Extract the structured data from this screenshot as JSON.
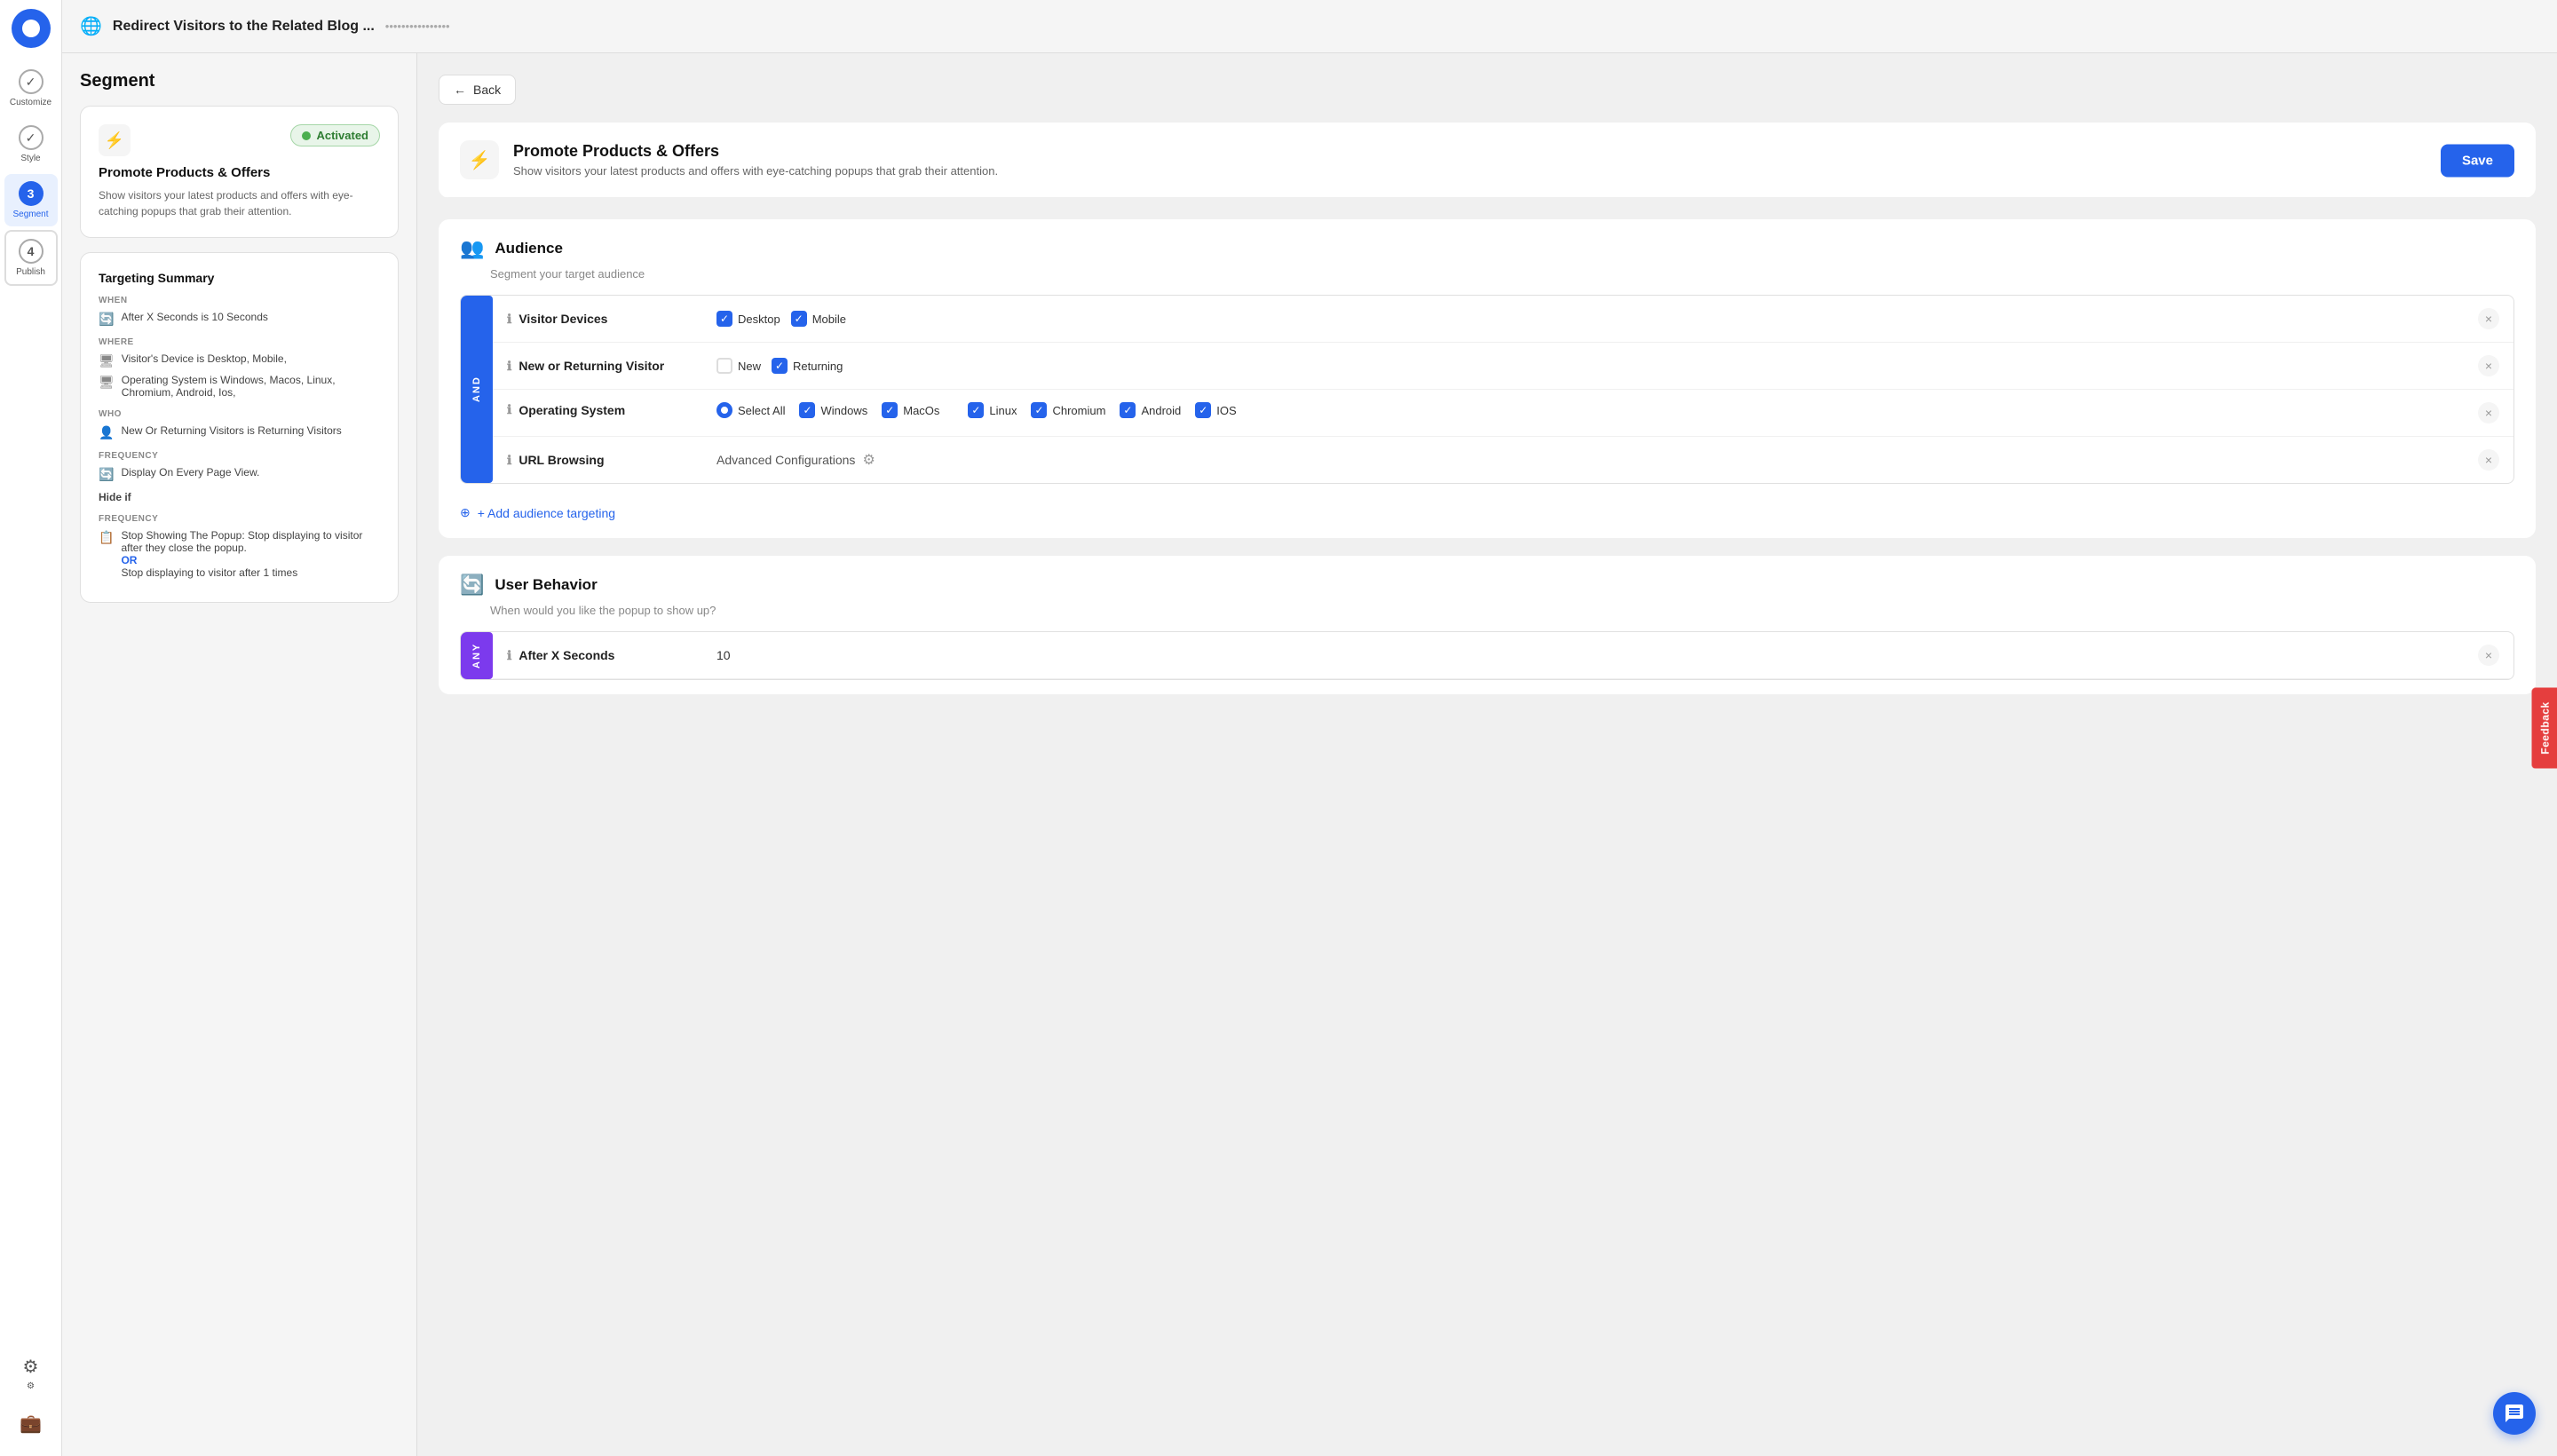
{
  "app": {
    "logo_icon": "●",
    "top_bar": {
      "globe_icon": "🌐",
      "title": "Redirect Visitors to the Related Blog ...",
      "subtitle": "••••••••••••••••"
    }
  },
  "nav": {
    "items": [
      {
        "id": "customize",
        "label": "Customize",
        "icon": "✓",
        "active": false,
        "step": null
      },
      {
        "id": "style",
        "label": "Style",
        "icon": "✓",
        "active": false,
        "step": null
      },
      {
        "id": "segment",
        "label": "Segment",
        "icon": null,
        "active": true,
        "step": "3"
      },
      {
        "id": "publish",
        "label": "Publish",
        "icon": null,
        "active": false,
        "step": "4"
      }
    ],
    "settings_icon": "⚙",
    "briefcase_icon": "💼"
  },
  "sidebar": {
    "title": "Segment",
    "card": {
      "icon": "⚡",
      "activated_label": "Activated",
      "title": "Promote Products & Offers",
      "description": "Show visitors your latest products and offers with eye-catching popups that grab their attention."
    },
    "targeting_summary": {
      "title": "Targeting Summary",
      "when_label": "WHEN",
      "when_items": [
        {
          "icon": "🔄",
          "text": "After X Seconds is 10 Seconds"
        }
      ],
      "where_label": "WHERE",
      "where_items": [
        {
          "icon": "🖥",
          "text": "Visitor's Device is Desktop, Mobile,"
        },
        {
          "icon": "🖥",
          "text": "Operating System is Windows, Macos, Linux, Chromium, Android, Ios,"
        }
      ],
      "who_label": "WHO",
      "who_items": [
        {
          "icon": "👤",
          "text": "New Or Returning Visitors is Returning Visitors"
        }
      ],
      "frequency_label": "FREQUENCY",
      "frequency_items": [
        {
          "icon": "🔄",
          "text": "Display On Every Page View."
        }
      ],
      "hide_if_label": "Hide if",
      "hide_frequency_label": "FREQUENCY",
      "hide_items": [
        {
          "icon": "📋",
          "text": "Stop Showing The Popup: Stop displaying to visitor after they close the popup.",
          "or": true,
          "or_text": "OR",
          "text2": "Stop displaying to visitor after 1 times"
        }
      ]
    }
  },
  "content": {
    "back_button": "Back",
    "main_card": {
      "icon": "⚡",
      "title": "Promote Products & Offers",
      "description": "Show visitors your latest products and offers with eye-catching popups that grab their attention.",
      "save_label": "Save"
    },
    "audience_section": {
      "icon": "👥",
      "title": "Audience",
      "subtitle": "Segment your target audience",
      "and_label": "AND",
      "conditions": [
        {
          "id": "visitor-devices",
          "label": "Visitor Devices",
          "values": [
            {
              "type": "checkbox-checked",
              "label": "Desktop"
            },
            {
              "type": "checkbox-checked",
              "label": "Mobile"
            }
          ]
        },
        {
          "id": "new-returning",
          "label": "New or Returning Visitor",
          "values": [
            {
              "type": "checkbox-unchecked",
              "label": "New"
            },
            {
              "type": "checkbox-checked",
              "label": "Returning"
            }
          ]
        },
        {
          "id": "operating-system",
          "label": "Operating System",
          "values": [
            {
              "type": "radio-checked",
              "label": "Select All"
            },
            {
              "type": "checkbox-checked",
              "label": "Windows"
            },
            {
              "type": "checkbox-checked",
              "label": "MacOs"
            },
            {
              "type": "checkbox-checked",
              "label": "Linux"
            },
            {
              "type": "checkbox-checked",
              "label": "Chromium"
            },
            {
              "type": "checkbox-checked",
              "label": "Android"
            },
            {
              "type": "checkbox-checked",
              "label": "IOS"
            }
          ]
        },
        {
          "id": "url-browsing",
          "label": "URL Browsing",
          "values": [
            {
              "type": "text",
              "label": "Advanced Configurations"
            }
          ]
        }
      ],
      "add_targeting_label": "+ Add audience targeting"
    },
    "user_behavior_section": {
      "icon": "🔄",
      "title": "User Behavior",
      "subtitle": "When would you like the popup to show up?",
      "any_label": "ANY",
      "conditions": [
        {
          "id": "after-x-seconds",
          "label": "After X Seconds",
          "value": "10"
        }
      ]
    }
  },
  "feedback": {
    "label": "Feedback"
  }
}
